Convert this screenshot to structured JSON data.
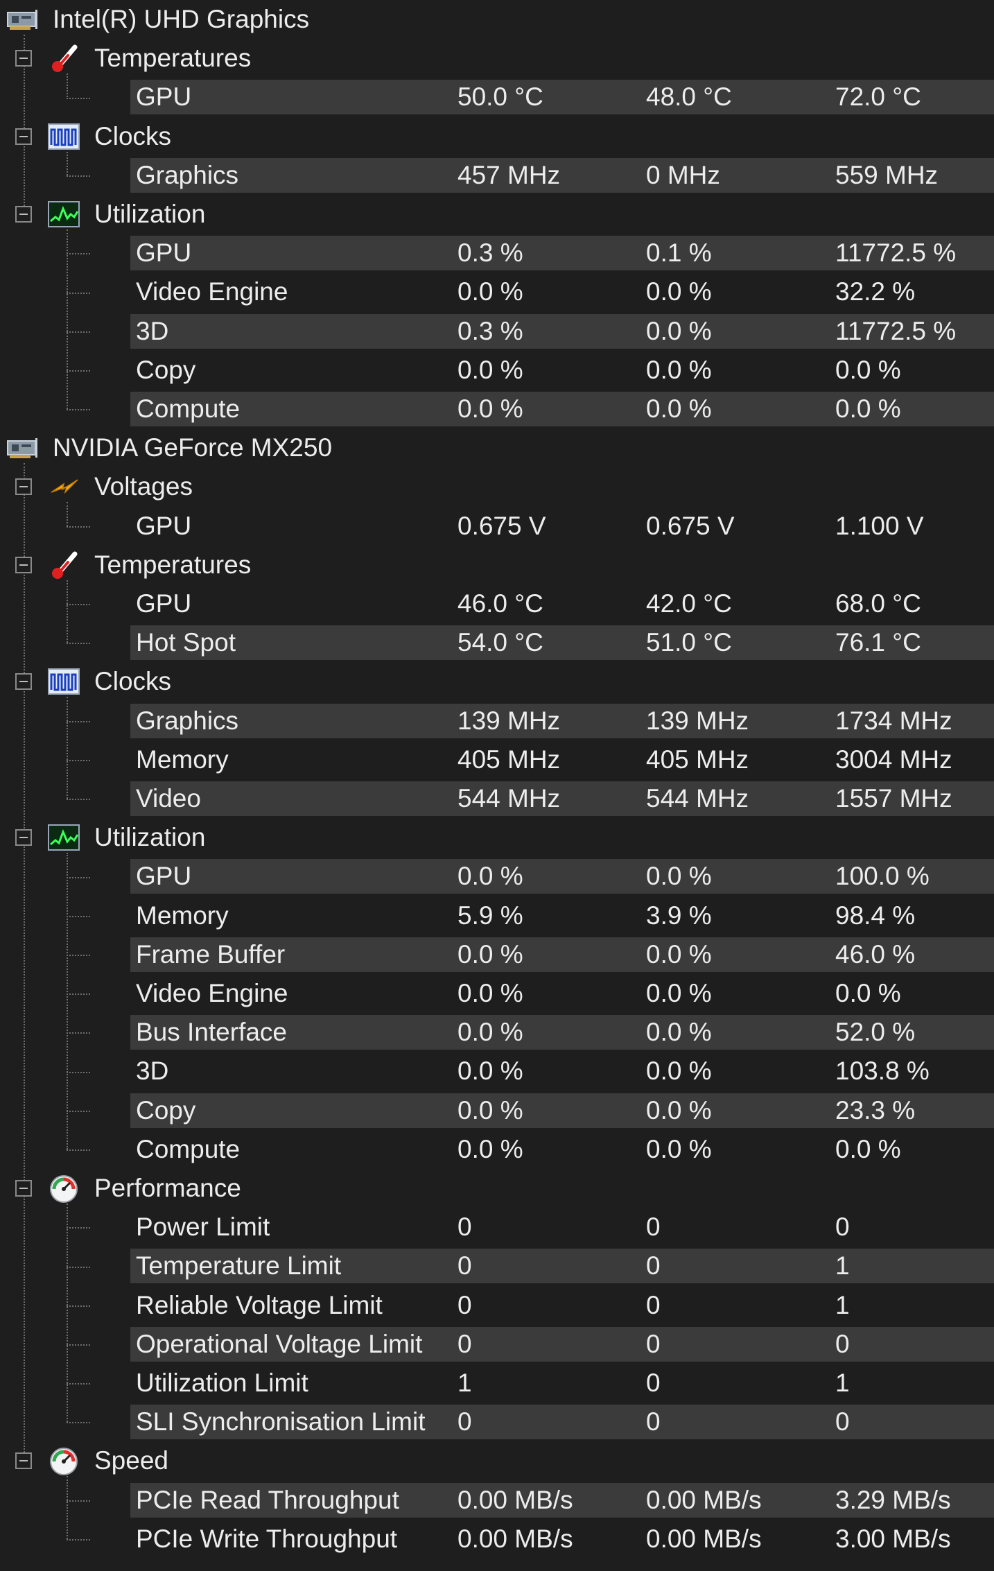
{
  "devices": [
    {
      "name": "Intel(R) UHD Graphics",
      "groups": [
        {
          "label": "Temperatures",
          "icon": "thermometer-icon",
          "rows": [
            {
              "label": "GPU",
              "values": [
                "50.0 °C",
                "48.0 °C",
                "72.0 °C"
              ]
            }
          ]
        },
        {
          "label": "Clocks",
          "icon": "clock-waveform-icon",
          "rows": [
            {
              "label": "Graphics",
              "values": [
                "457 MHz",
                "0 MHz",
                "559 MHz"
              ]
            }
          ]
        },
        {
          "label": "Utilization",
          "icon": "utilization-graph-icon",
          "rows": [
            {
              "label": "GPU",
              "values": [
                "0.3 %",
                "0.1 %",
                "11772.5 %"
              ]
            },
            {
              "label": "Video Engine",
              "values": [
                "0.0 %",
                "0.0 %",
                "32.2 %"
              ]
            },
            {
              "label": "3D",
              "values": [
                "0.3 %",
                "0.0 %",
                "11772.5 %"
              ]
            },
            {
              "label": "Copy",
              "values": [
                "0.0 %",
                "0.0 %",
                "0.0 %"
              ]
            },
            {
              "label": "Compute",
              "values": [
                "0.0 %",
                "0.0 %",
                "0.0 %"
              ]
            }
          ]
        }
      ]
    },
    {
      "name": "NVIDIA GeForce MX250",
      "groups": [
        {
          "label": "Voltages",
          "icon": "lightning-bolt-icon",
          "rows": [
            {
              "label": "GPU",
              "values": [
                "0.675 V",
                "0.675 V",
                "1.100 V"
              ]
            }
          ]
        },
        {
          "label": "Temperatures",
          "icon": "thermometer-icon",
          "rows": [
            {
              "label": "GPU",
              "values": [
                "46.0 °C",
                "42.0 °C",
                "68.0 °C"
              ]
            },
            {
              "label": "Hot Spot",
              "values": [
                "54.0 °C",
                "51.0 °C",
                "76.1 °C"
              ]
            }
          ]
        },
        {
          "label": "Clocks",
          "icon": "clock-waveform-icon",
          "rows": [
            {
              "label": "Graphics",
              "values": [
                "139 MHz",
                "139 MHz",
                "1734 MHz"
              ]
            },
            {
              "label": "Memory",
              "values": [
                "405 MHz",
                "405 MHz",
                "3004 MHz"
              ]
            },
            {
              "label": "Video",
              "values": [
                "544 MHz",
                "544 MHz",
                "1557 MHz"
              ]
            }
          ]
        },
        {
          "label": "Utilization",
          "icon": "utilization-graph-icon",
          "rows": [
            {
              "label": "GPU",
              "values": [
                "0.0 %",
                "0.0 %",
                "100.0 %"
              ]
            },
            {
              "label": "Memory",
              "values": [
                "5.9 %",
                "3.9 %",
                "98.4 %"
              ]
            },
            {
              "label": "Frame Buffer",
              "values": [
                "0.0 %",
                "0.0 %",
                "46.0 %"
              ]
            },
            {
              "label": "Video Engine",
              "values": [
                "0.0 %",
                "0.0 %",
                "0.0 %"
              ]
            },
            {
              "label": "Bus Interface",
              "values": [
                "0.0 %",
                "0.0 %",
                "52.0 %"
              ]
            },
            {
              "label": "3D",
              "values": [
                "0.0 %",
                "0.0 %",
                "103.8 %"
              ]
            },
            {
              "label": "Copy",
              "values": [
                "0.0 %",
                "0.0 %",
                "23.3 %"
              ]
            },
            {
              "label": "Compute",
              "values": [
                "0.0 %",
                "0.0 %",
                "0.0 %"
              ]
            }
          ]
        },
        {
          "label": "Performance",
          "icon": "speedometer-icon",
          "rows": [
            {
              "label": "Power Limit",
              "values": [
                "0",
                "0",
                "0"
              ]
            },
            {
              "label": "Temperature Limit",
              "values": [
                "0",
                "0",
                "1"
              ]
            },
            {
              "label": "Reliable Voltage Limit",
              "values": [
                "0",
                "0",
                "1"
              ]
            },
            {
              "label": "Operational Voltage Limit",
              "values": [
                "0",
                "0",
                "0"
              ]
            },
            {
              "label": "Utilization Limit",
              "values": [
                "1",
                "0",
                "1"
              ]
            },
            {
              "label": "SLI Synchronisation Limit",
              "values": [
                "0",
                "0",
                "0"
              ]
            }
          ]
        },
        {
          "label": "Speed",
          "icon": "speedometer-icon",
          "rows": [
            {
              "label": "PCIe Read Throughput",
              "values": [
                "0.00 MB/s",
                "0.00 MB/s",
                "3.29 MB/s"
              ]
            },
            {
              "label": "PCIe Write Throughput",
              "values": [
                "0.00 MB/s",
                "0.00 MB/s",
                "3.00 MB/s"
              ]
            }
          ]
        }
      ]
    }
  ],
  "device_icon": "graphics-card-icon",
  "colors": {
    "background": "#1e1e1e",
    "row_band": "#3b3b3b",
    "text": "#ededed",
    "tree_line": "#6e6e6e"
  }
}
